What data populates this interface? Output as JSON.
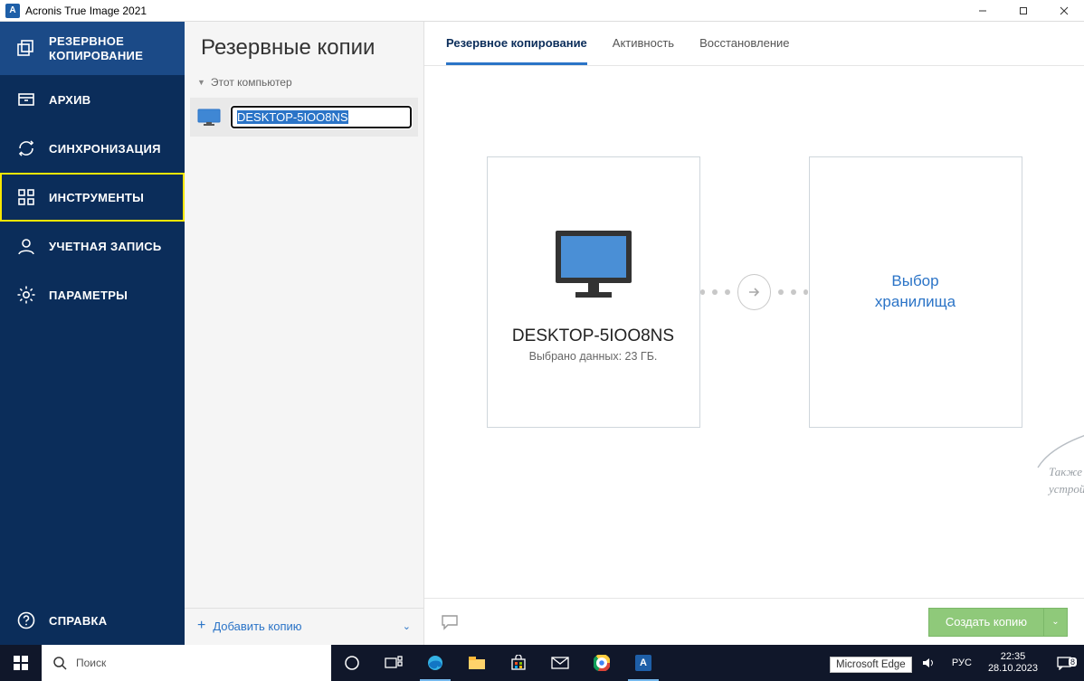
{
  "window": {
    "title": "Acronis True Image 2021",
    "app_icon_letter": "A"
  },
  "sidebar": {
    "items": [
      {
        "label": "РЕЗЕРВНОЕ КОПИРОВАНИЕ"
      },
      {
        "label": "АРХИВ"
      },
      {
        "label": "СИНХРОНИЗАЦИЯ"
      },
      {
        "label": "ИНСТРУМЕНТЫ"
      },
      {
        "label": "УЧЕТНАЯ ЗАПИСЬ"
      },
      {
        "label": "ПАРАМЕТРЫ"
      }
    ],
    "help_label": "СПРАВКА"
  },
  "listpanel": {
    "title": "Резервные копии",
    "group_label": "Этот компьютер",
    "entry_name": "DESKTOP-5IOO8NS",
    "add_label": "Добавить копию"
  },
  "tabs": {
    "backup": "Резервное копирование",
    "activity": "Активность",
    "recovery": "Восстановление"
  },
  "source_card": {
    "name": "DESKTOP-5IOO8NS",
    "sub": "Выбрано данных: 23 ГБ."
  },
  "dest_card": {
    "line1": "Выбор",
    "line2": "хранилища"
  },
  "hint_text": "Также доступны диски, файлы, мобильные устройства и облачные сервисы",
  "create_button": "Создать копию",
  "tooltip": "Microsoft Edge",
  "taskbar": {
    "search_placeholder": "Поиск",
    "lang": "РУС",
    "time": "22:35",
    "date": "28.10.2023",
    "notif_count": "8"
  }
}
